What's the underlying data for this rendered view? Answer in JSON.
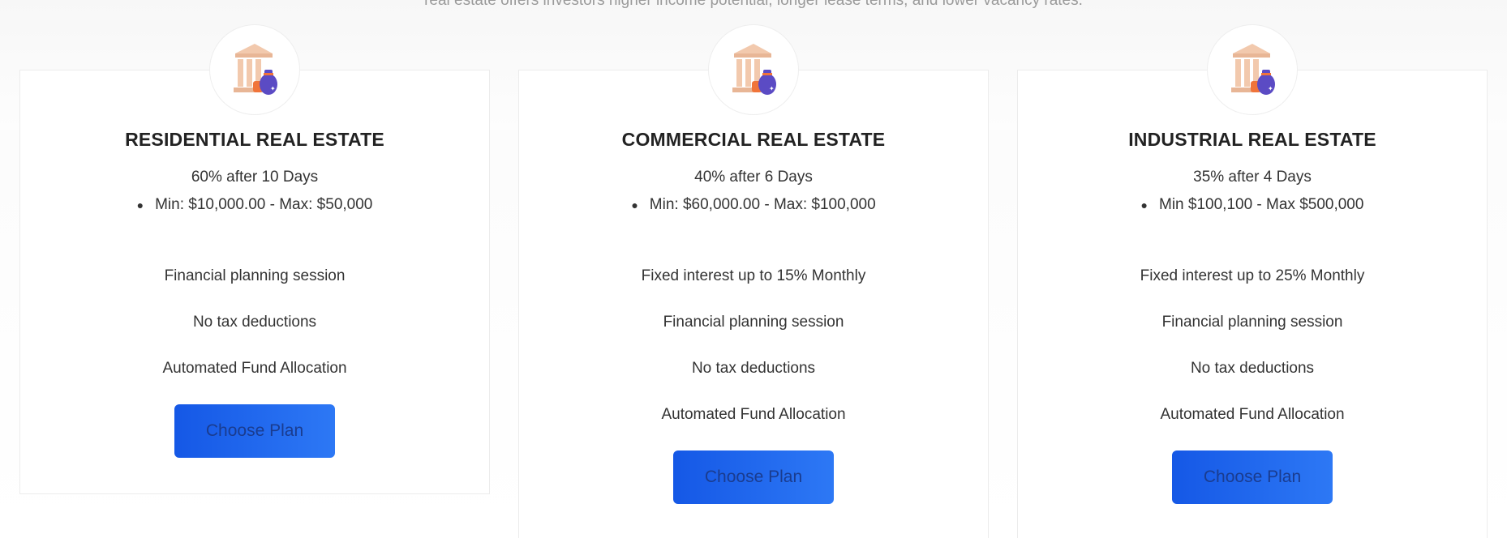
{
  "intro_text": "real estate offers investors higher income potential, longer lease terms, and lower vacancy rates.",
  "plans": [
    {
      "title": "RESIDENTIAL REAL ESTATE",
      "rate": "60% after 10 Days",
      "range": "Min: $10,000.00 - Max: $50,000",
      "features": [
        "Financial planning session",
        "No tax deductions",
        "Automated Fund Allocation"
      ],
      "button": "Choose Plan",
      "icon": "bank-moneybag-icon"
    },
    {
      "title": "COMMERCIAL REAL ESTATE",
      "rate": "40% after 6 Days",
      "range": "Min: $60,000.00 - Max: $100,000",
      "features": [
        "Fixed interest up to 15% Monthly",
        "Financial planning session",
        "No tax deductions",
        "Automated Fund Allocation"
      ],
      "button": "Choose Plan",
      "icon": "bank-moneybag-icon"
    },
    {
      "title": "INDUSTRIAL REAL ESTATE",
      "rate": "35% after 4 Days",
      "range": "Min $100,100 - Max $500,000",
      "features": [
        "Fixed interest up to 25% Monthly",
        "Financial planning session",
        "No tax deductions",
        "Automated Fund Allocation"
      ],
      "button": "Choose Plan",
      "icon": "bank-moneybag-icon"
    }
  ],
  "colors": {
    "button_start": "#1558e6",
    "button_end": "#2d78f5",
    "button_text": "#1a3c8f",
    "icon_building": "#f2c9ad",
    "icon_bag": "#5b4bc4",
    "icon_accent": "#f0743a"
  }
}
